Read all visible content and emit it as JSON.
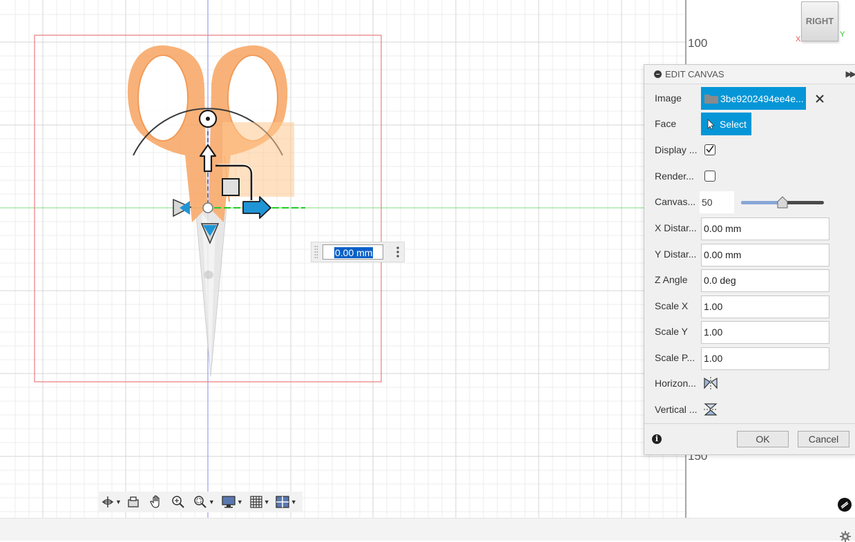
{
  "ruler": {
    "label_top": "100",
    "label_bottom": "150"
  },
  "viewcube": {
    "face": "RIGHT",
    "axis_x": "X",
    "axis_y": "Y"
  },
  "dimension_input": {
    "value": "0.00 mm"
  },
  "panel": {
    "title": "EDIT CANVAS",
    "image": {
      "label": "Image",
      "value": "3be9202494ee4e..."
    },
    "face": {
      "label": "Face",
      "button": "Select"
    },
    "display": {
      "label": "Display ...",
      "checked": true
    },
    "render": {
      "label": "Render...",
      "checked": false
    },
    "canvas_opacity": {
      "label": "Canvas...",
      "value": "50",
      "level": 0.5
    },
    "x_distance": {
      "label": "X Distar...",
      "value": "0.00 mm"
    },
    "y_distance": {
      "label": "Y Distar...",
      "value": "0.00 mm"
    },
    "z_angle": {
      "label": "Z Angle",
      "value": "0.0 deg"
    },
    "scale_x": {
      "label": "Scale X",
      "value": "1.00"
    },
    "scale_y": {
      "label": "Scale Y",
      "value": "1.00"
    },
    "scale_p": {
      "label": "Scale P...",
      "value": "1.00"
    },
    "horizontal": {
      "label": "Horizon..."
    },
    "vertical": {
      "label": "Vertical ..."
    },
    "ok": "OK",
    "cancel": "Cancel"
  },
  "colors": {
    "accent": "#0696d7",
    "canvas_border": "#e05555",
    "x_axis": "#22cc22",
    "y_axis": "#4444ff",
    "scissors": "#f5a25c"
  },
  "icons": [
    "orbit-icon",
    "look-at-icon",
    "pan-icon",
    "zoom-icon",
    "zoom-window-icon",
    "display-settings-icon",
    "grid-icon",
    "viewports-icon",
    "settings-icon",
    "flip-horizontal-icon",
    "flip-vertical-icon",
    "info-icon",
    "folder-icon",
    "cursor-icon"
  ]
}
